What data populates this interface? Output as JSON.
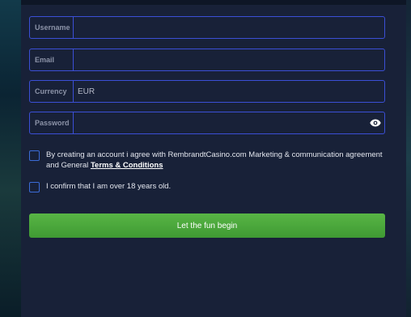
{
  "form": {
    "username": {
      "label": "Username",
      "value": "",
      "placeholder": ""
    },
    "email": {
      "label": "Email",
      "value": "",
      "placeholder": ""
    },
    "currency": {
      "label": "Currency",
      "value": "EUR",
      "placeholder": ""
    },
    "password": {
      "label": "Password",
      "value": "",
      "placeholder": ""
    }
  },
  "agreements": {
    "marketing_text": "By creating an account i agree with RembrandtCasino.com Marketing & communication agreement and General ",
    "terms_link": "Terms & Conditions",
    "age_text": "I confirm that I am over 18 years old."
  },
  "submit_label": "Let the fun begin",
  "icons": {
    "password_toggle": "eye-icon"
  },
  "colors": {
    "panel": "#182138",
    "field_border": "#3b4fd6",
    "button": "#4caf3f"
  }
}
